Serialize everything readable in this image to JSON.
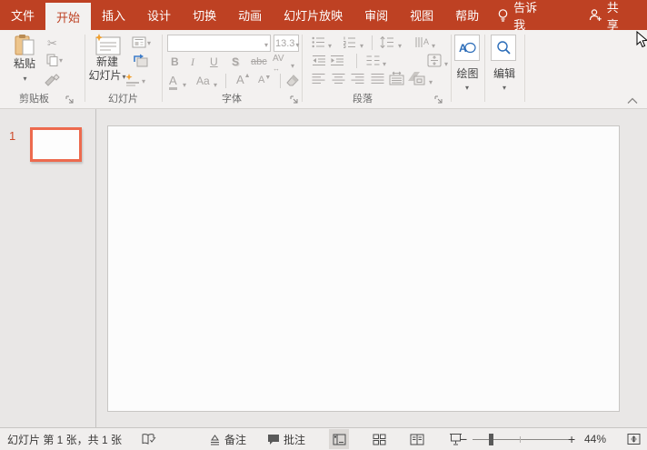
{
  "titlebar": {
    "tabs": [
      "文件",
      "开始",
      "插入",
      "设计",
      "切换",
      "动画",
      "幻灯片放映",
      "审阅",
      "视图",
      "帮助"
    ],
    "active_tab": "开始",
    "tell_me": "告诉我",
    "share": "共享"
  },
  "ribbon": {
    "clipboard": {
      "paste": "粘贴",
      "label": "剪贴板"
    },
    "slides": {
      "new_slide_line1": "新建",
      "new_slide_line2": "幻灯片",
      "label": "幻灯片"
    },
    "font": {
      "font_name": "",
      "font_size": "13.3",
      "bold": "B",
      "italic": "I",
      "underline": "U",
      "shadow": "S",
      "strikethrough": "abc",
      "spacing": "AV",
      "font_color": "A",
      "change_case": "Aa",
      "grow_font": "A",
      "shrink_font": "A",
      "label": "字体"
    },
    "paragraph": {
      "label": "段落"
    },
    "drawing": {
      "label": "绘图"
    },
    "editing": {
      "label": "编辑"
    }
  },
  "slide_panel": {
    "slide_number": "1"
  },
  "statusbar": {
    "slide_info": "幻灯片 第 1 张，共 1 张",
    "notes": "备注",
    "comments": "批注",
    "zoom_level": "44%"
  },
  "colors": {
    "accent": "#BE4123",
    "ribbon_bg": "#F3F1F0",
    "thumbnail_border": "#ED6A4E",
    "disabled_icon": "#A9A6A4",
    "enabled_blue": "#2B6CB8"
  }
}
